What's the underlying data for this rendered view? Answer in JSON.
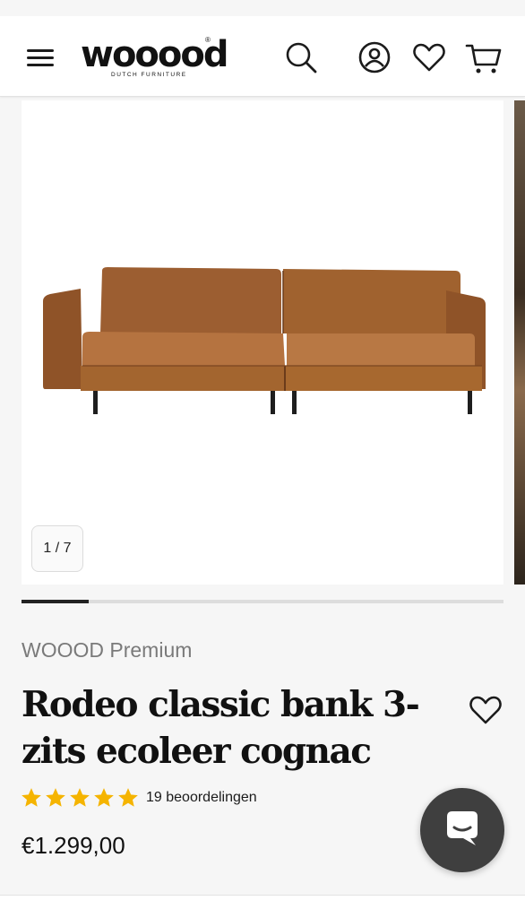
{
  "header": {
    "logo_text": "wooood",
    "logo_registered": "®",
    "logo_sub": "DUTCH FURNITURE",
    "icons": [
      "menu-icon",
      "search-icon",
      "account-icon",
      "wishlist-icon",
      "cart-icon"
    ]
  },
  "gallery": {
    "counter": "1 / 7",
    "progress": 0.14
  },
  "product": {
    "brand": "WOOOD Premium",
    "title": "Rodeo classic bank 3-zits ecoleer cognac",
    "rating_stars": 5,
    "reviews": "19 beoordelingen",
    "price": "€1.299,00"
  },
  "colors": {
    "star": "#f5b400",
    "chat_bg": "#3f3f3f",
    "sofa": "#a8683a"
  }
}
